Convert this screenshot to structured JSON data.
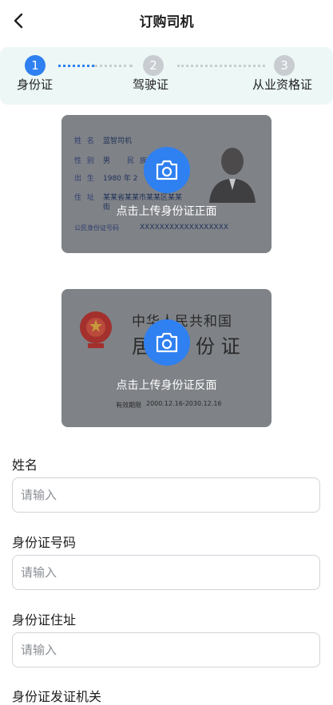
{
  "header": {
    "title": "订购司机"
  },
  "stepper": {
    "steps": [
      {
        "number": "1",
        "label": "身份证",
        "state": "active"
      },
      {
        "number": "2",
        "label": "驾驶证",
        "state": "pending"
      },
      {
        "number": "3",
        "label": "从业资格证",
        "state": "pending"
      }
    ]
  },
  "id_front": {
    "upload_label": "点击上传身份证正面",
    "fields": {
      "name_key": "姓 名",
      "name_val": "蓝智司机",
      "sex_key": "性 别",
      "sex_val": "男",
      "ethnic_key": "民 族",
      "birth_key": "出 生",
      "birth_val": "1980  年  2",
      "addr_key": "住 址",
      "addr_val": "某某省某某市某某区某某",
      "addr_val2": "街",
      "idno_key": "公民身份证号码",
      "idno_val": "XXXXXXXXXXXXXXXXXX"
    }
  },
  "id_back": {
    "upload_label": "点击上传身份证反面",
    "country": "中华人民共和国",
    "title_left": "居",
    "title_right": "份 证",
    "valid_key": "有效期限",
    "valid_val": "2000.12.16-2030.12.16"
  },
  "form": {
    "name": {
      "label": "姓名",
      "placeholder": "请输入",
      "value": ""
    },
    "idno": {
      "label": "身份证号码",
      "placeholder": "请输入",
      "value": ""
    },
    "address": {
      "label": "身份证住址",
      "placeholder": "请输入",
      "value": ""
    },
    "authority": {
      "label": "身份证发证机关"
    }
  },
  "colors": {
    "accent": "#2f80f0",
    "stepper_bg": "#ecf7f6",
    "inactive": "#c9cdd1"
  }
}
